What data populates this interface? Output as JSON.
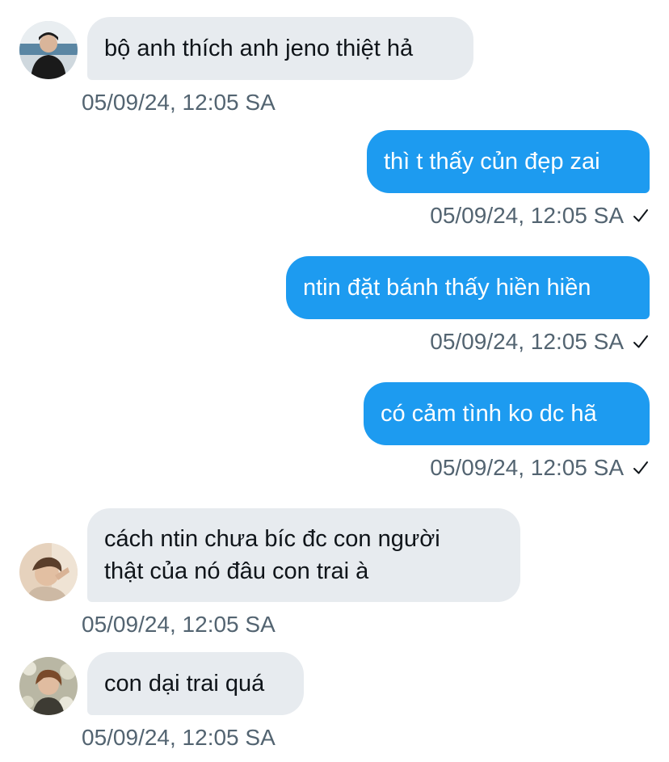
{
  "conversation": {
    "messages": [
      {
        "direction": "incoming",
        "avatar_icon": "user-avatar-1-icon",
        "lines": [
          "bộ anh thích anh jeno thiệt hả"
        ],
        "timestamp": "05/09/24, 12:05 SA"
      },
      {
        "direction": "outgoing",
        "lines": [
          "thì t thấy củn đẹp zai"
        ],
        "timestamp": "05/09/24, 12:05 SA",
        "status_icon": "sent-check-icon"
      },
      {
        "direction": "outgoing",
        "lines": [
          "ntin đặt bánh thấy hiền hiền"
        ],
        "timestamp": "05/09/24, 12:05 SA",
        "status_icon": "sent-check-icon"
      },
      {
        "direction": "outgoing",
        "lines": [
          "có cảm tình ko dc hã"
        ],
        "timestamp": "05/09/24, 12:05 SA",
        "status_icon": "sent-check-icon"
      },
      {
        "direction": "incoming",
        "avatar_icon": "user-avatar-2-icon",
        "lines": [
          "cách ntin chưa bíc đc con người",
          "thật của nó đâu con trai à"
        ],
        "timestamp": "05/09/24, 12:05 SA"
      },
      {
        "direction": "incoming",
        "avatar_icon": "user-avatar-3-icon",
        "lines": [
          "con dại trai quá"
        ],
        "timestamp": "05/09/24, 12:05 SA"
      }
    ]
  },
  "colors": {
    "incoming_bubble": "#e7ebef",
    "outgoing_bubble": "#1d9bf0",
    "timestamp_text": "#536471",
    "incoming_text": "#0f1419",
    "outgoing_text": "#ffffff"
  }
}
